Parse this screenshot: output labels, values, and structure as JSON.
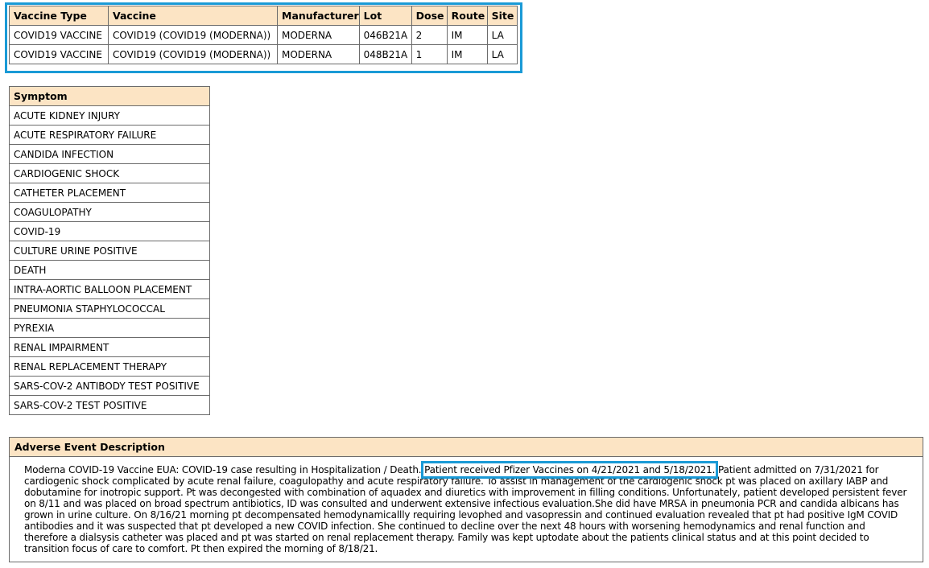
{
  "vaccine_table": {
    "headers": [
      "Vaccine Type",
      "Vaccine",
      "Manufacturer",
      "Lot",
      "Dose",
      "Route",
      "Site"
    ],
    "rows": [
      [
        "COVID19 VACCINE",
        "COVID19 (COVID19 (MODERNA))",
        "MODERNA",
        "046B21A",
        "2",
        "IM",
        "LA"
      ],
      [
        "COVID19 VACCINE",
        "COVID19 (COVID19 (MODERNA))",
        "MODERNA",
        "048B21A",
        "1",
        "IM",
        "LA"
      ]
    ]
  },
  "symptom_table": {
    "header": "Symptom",
    "items": [
      "ACUTE KIDNEY INJURY",
      "ACUTE RESPIRATORY FAILURE",
      "CANDIDA INFECTION",
      "CARDIOGENIC SHOCK",
      "CATHETER PLACEMENT",
      "COAGULOPATHY",
      "COVID-19",
      "CULTURE URINE POSITIVE",
      "DEATH",
      "INTRA-AORTIC BALLOON PLACEMENT",
      "PNEUMONIA STAPHYLOCOCCAL",
      "PYREXIA",
      "RENAL IMPAIRMENT",
      "RENAL REPLACEMENT THERAPY",
      "SARS-COV-2 ANTIBODY TEST POSITIVE",
      "SARS-COV-2 TEST POSITIVE"
    ]
  },
  "adverse_event": {
    "header": "Adverse Event Description",
    "text_before": "Moderna COVID-19 Vaccine EUA: COVID-19 case resulting in Hospitalization / Death. ",
    "highlighted": "Patient received Pfizer Vaccines on 4/21/2021 and 5/18/2021.",
    "text_after": " Patient admitted on 7/31/2021 for cardiogenic shock complicated by acute renal failure, coagulopathy and acute respiratory failure. To assist in management of the cardiogenic shock pt was placed on axillary IABP and dobutamine for inotropic support. Pt was decongested with combination of aquadex and diuretics with improvement in filling conditions. Unfortunately, patient developed persistent fever on 8/11 and was placed on broad spectrum antibiotics, ID was consulted and underwent extensive infectious evaluation.She did have MRSA in pneumonia PCR and candida albicans has grown in urine culture. On 8/16/21 morning pt decompensated hemodynamicallly requiring levophed and vasopressin and continued evaluation revealed that pt had positive IgM COVID antibodies and it was suspected that pt developed a new COVID infection. She continued to decline over the next 48 hours with worsening hemodynamics and renal function and therefore a dialsysis catheter was placed and pt was started on renal replacement therapy. Family was kept uptodate about the patients clinical status and at this point decided to transition focus of care to comfort. Pt then expired the morning of 8/18/21."
  },
  "colors": {
    "header_bg": "#fce4c4",
    "highlight_border": "#1a9ad6",
    "grid_border": "#6b6b6b"
  }
}
